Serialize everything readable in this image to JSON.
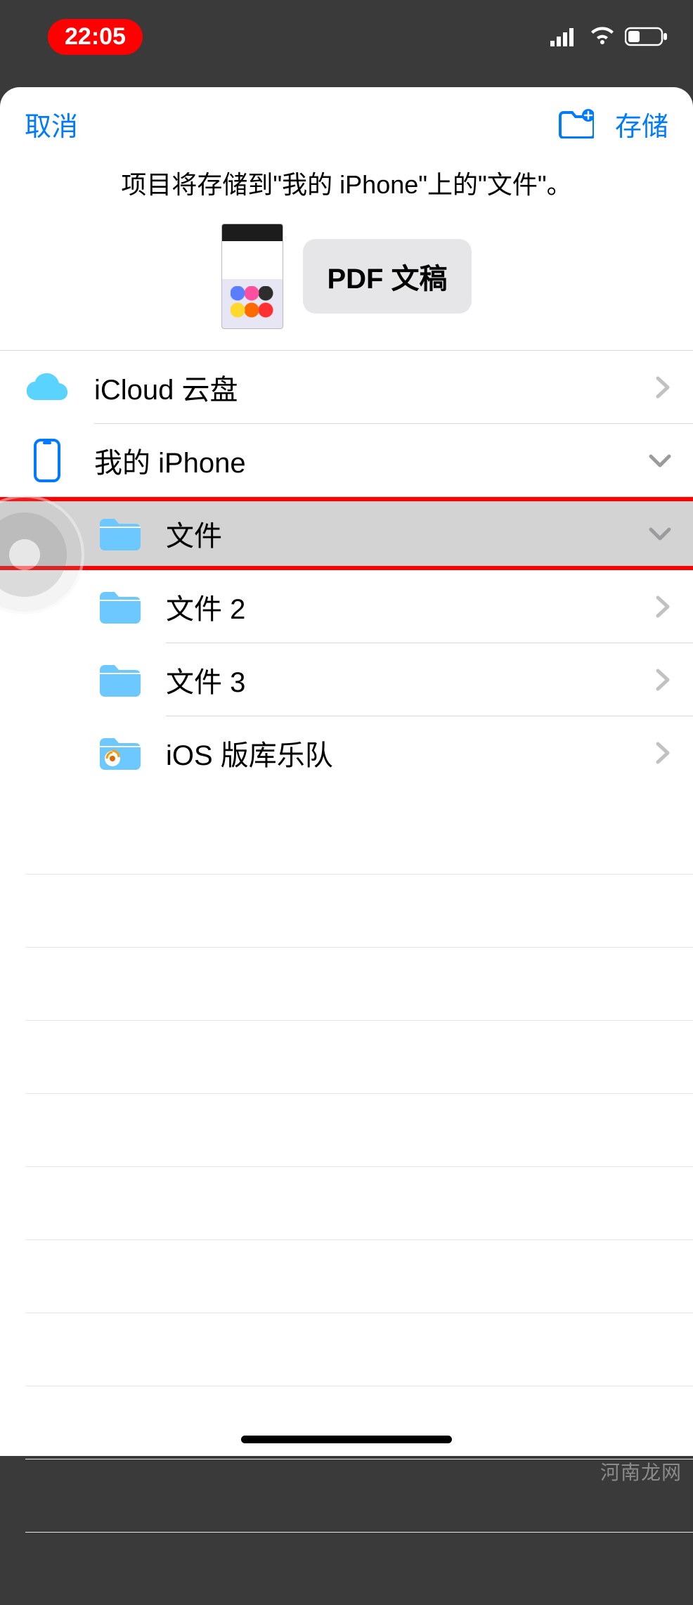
{
  "status": {
    "time": "22:05"
  },
  "nav": {
    "cancel": "取消",
    "save": "存储"
  },
  "subtitle": "项目将存储到\"我的 iPhone\"上的\"文件\"。",
  "file_badge": "PDF 文稿",
  "locations": {
    "icloud": "iCloud 云盘",
    "my_iphone": "我的 iPhone"
  },
  "folders": [
    {
      "name": "文件",
      "selected": true,
      "chev": "down"
    },
    {
      "name": "文件 2",
      "selected": false,
      "chev": "right"
    },
    {
      "name": "文件 3",
      "selected": false,
      "chev": "right"
    },
    {
      "name": "iOS 版库乐队",
      "selected": false,
      "chev": "right"
    }
  ],
  "watermark": "河南龙网"
}
